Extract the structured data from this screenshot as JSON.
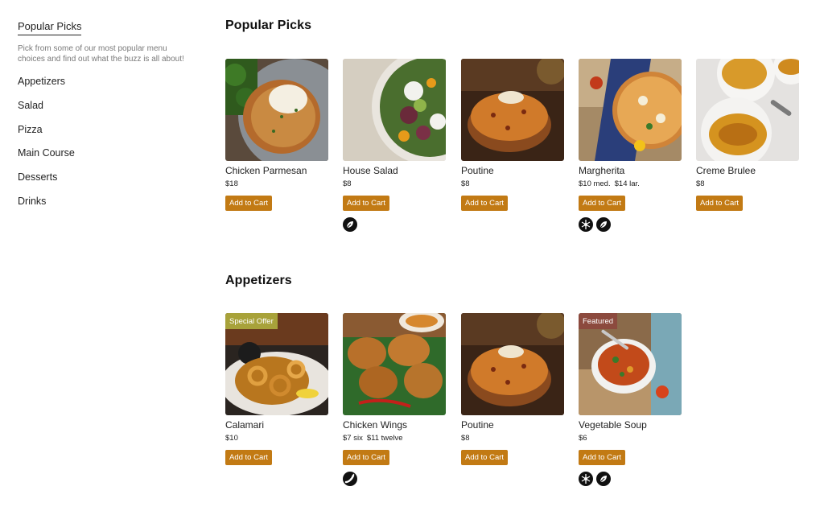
{
  "sidebar": {
    "active": "Popular Picks",
    "description": "Pick from some of our most popular menu choices and find out what the buzz is all about!",
    "items": [
      "Appetizers",
      "Salad",
      "Pizza",
      "Main Course",
      "Desserts",
      "Drinks"
    ]
  },
  "sections": {
    "popular": {
      "title": "Popular Picks",
      "items": [
        {
          "name": "Chicken Parmesan",
          "price1": "$18",
          "price2": "",
          "button": "Add to Cart"
        },
        {
          "name": "House Salad",
          "price1": "$8",
          "price2": "",
          "button": "Add to Cart",
          "icons": [
            "leaf-icon"
          ]
        },
        {
          "name": "Poutine",
          "price1": "$8",
          "price2": "",
          "button": "Add to Cart"
        },
        {
          "name": "Margherita",
          "price1": "$10 med.",
          "price2": "$14 lar.",
          "button": "Add to Cart",
          "icons": [
            "wheat-free-icon",
            "leaf-icon"
          ]
        },
        {
          "name": "Creme Brulee",
          "price1": "$8",
          "price2": "",
          "button": "Add to Cart"
        }
      ]
    },
    "appetizers": {
      "title": "Appetizers",
      "items": [
        {
          "name": "Calamari",
          "price1": "$10",
          "price2": "",
          "button": "Add to Cart",
          "badge": "Special Offer"
        },
        {
          "name": "Chicken Wings",
          "price1": "$7 six",
          "price2": "$11 twelve",
          "button": "Add to Cart",
          "icons": [
            "chili-icon"
          ]
        },
        {
          "name": "Poutine",
          "price1": "$8",
          "price2": "",
          "button": "Add to Cart"
        },
        {
          "name": "Vegetable Soup",
          "price1": "$6",
          "price2": "",
          "button": "Add to Cart",
          "badge": "Featured",
          "icons": [
            "wheat-free-icon",
            "leaf-icon"
          ]
        }
      ]
    }
  },
  "colors": {
    "button": "#c27a14",
    "badge_special": "#a8a23a",
    "badge_featured": "#8c4a3e"
  }
}
